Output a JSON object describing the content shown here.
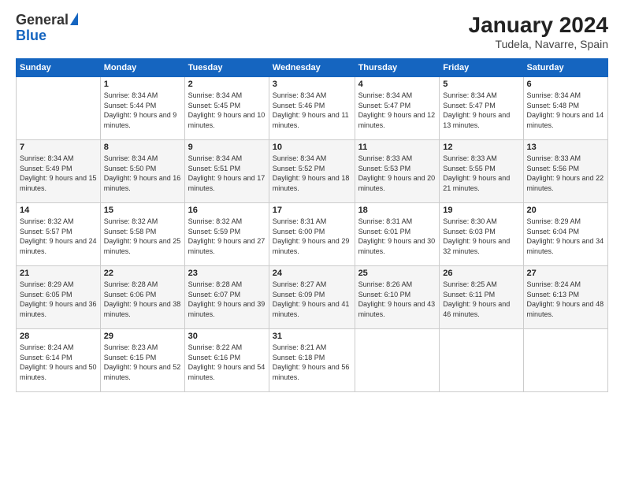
{
  "header": {
    "logo_general": "General",
    "logo_blue": "Blue",
    "month_title": "January 2024",
    "location": "Tudela, Navarre, Spain"
  },
  "days_of_week": [
    "Sunday",
    "Monday",
    "Tuesday",
    "Wednesday",
    "Thursday",
    "Friday",
    "Saturday"
  ],
  "weeks": [
    [
      {
        "day": "",
        "sunrise": "",
        "sunset": "",
        "daylight": ""
      },
      {
        "day": "1",
        "sunrise": "Sunrise: 8:34 AM",
        "sunset": "Sunset: 5:44 PM",
        "daylight": "Daylight: 9 hours and 9 minutes."
      },
      {
        "day": "2",
        "sunrise": "Sunrise: 8:34 AM",
        "sunset": "Sunset: 5:45 PM",
        "daylight": "Daylight: 9 hours and 10 minutes."
      },
      {
        "day": "3",
        "sunrise": "Sunrise: 8:34 AM",
        "sunset": "Sunset: 5:46 PM",
        "daylight": "Daylight: 9 hours and 11 minutes."
      },
      {
        "day": "4",
        "sunrise": "Sunrise: 8:34 AM",
        "sunset": "Sunset: 5:47 PM",
        "daylight": "Daylight: 9 hours and 12 minutes."
      },
      {
        "day": "5",
        "sunrise": "Sunrise: 8:34 AM",
        "sunset": "Sunset: 5:47 PM",
        "daylight": "Daylight: 9 hours and 13 minutes."
      },
      {
        "day": "6",
        "sunrise": "Sunrise: 8:34 AM",
        "sunset": "Sunset: 5:48 PM",
        "daylight": "Daylight: 9 hours and 14 minutes."
      }
    ],
    [
      {
        "day": "7",
        "sunrise": "Sunrise: 8:34 AM",
        "sunset": "Sunset: 5:49 PM",
        "daylight": "Daylight: 9 hours and 15 minutes."
      },
      {
        "day": "8",
        "sunrise": "Sunrise: 8:34 AM",
        "sunset": "Sunset: 5:50 PM",
        "daylight": "Daylight: 9 hours and 16 minutes."
      },
      {
        "day": "9",
        "sunrise": "Sunrise: 8:34 AM",
        "sunset": "Sunset: 5:51 PM",
        "daylight": "Daylight: 9 hours and 17 minutes."
      },
      {
        "day": "10",
        "sunrise": "Sunrise: 8:34 AM",
        "sunset": "Sunset: 5:52 PM",
        "daylight": "Daylight: 9 hours and 18 minutes."
      },
      {
        "day": "11",
        "sunrise": "Sunrise: 8:33 AM",
        "sunset": "Sunset: 5:53 PM",
        "daylight": "Daylight: 9 hours and 20 minutes."
      },
      {
        "day": "12",
        "sunrise": "Sunrise: 8:33 AM",
        "sunset": "Sunset: 5:55 PM",
        "daylight": "Daylight: 9 hours and 21 minutes."
      },
      {
        "day": "13",
        "sunrise": "Sunrise: 8:33 AM",
        "sunset": "Sunset: 5:56 PM",
        "daylight": "Daylight: 9 hours and 22 minutes."
      }
    ],
    [
      {
        "day": "14",
        "sunrise": "Sunrise: 8:32 AM",
        "sunset": "Sunset: 5:57 PM",
        "daylight": "Daylight: 9 hours and 24 minutes."
      },
      {
        "day": "15",
        "sunrise": "Sunrise: 8:32 AM",
        "sunset": "Sunset: 5:58 PM",
        "daylight": "Daylight: 9 hours and 25 minutes."
      },
      {
        "day": "16",
        "sunrise": "Sunrise: 8:32 AM",
        "sunset": "Sunset: 5:59 PM",
        "daylight": "Daylight: 9 hours and 27 minutes."
      },
      {
        "day": "17",
        "sunrise": "Sunrise: 8:31 AM",
        "sunset": "Sunset: 6:00 PM",
        "daylight": "Daylight: 9 hours and 29 minutes."
      },
      {
        "day": "18",
        "sunrise": "Sunrise: 8:31 AM",
        "sunset": "Sunset: 6:01 PM",
        "daylight": "Daylight: 9 hours and 30 minutes."
      },
      {
        "day": "19",
        "sunrise": "Sunrise: 8:30 AM",
        "sunset": "Sunset: 6:03 PM",
        "daylight": "Daylight: 9 hours and 32 minutes."
      },
      {
        "day": "20",
        "sunrise": "Sunrise: 8:29 AM",
        "sunset": "Sunset: 6:04 PM",
        "daylight": "Daylight: 9 hours and 34 minutes."
      }
    ],
    [
      {
        "day": "21",
        "sunrise": "Sunrise: 8:29 AM",
        "sunset": "Sunset: 6:05 PM",
        "daylight": "Daylight: 9 hours and 36 minutes."
      },
      {
        "day": "22",
        "sunrise": "Sunrise: 8:28 AM",
        "sunset": "Sunset: 6:06 PM",
        "daylight": "Daylight: 9 hours and 38 minutes."
      },
      {
        "day": "23",
        "sunrise": "Sunrise: 8:28 AM",
        "sunset": "Sunset: 6:07 PM",
        "daylight": "Daylight: 9 hours and 39 minutes."
      },
      {
        "day": "24",
        "sunrise": "Sunrise: 8:27 AM",
        "sunset": "Sunset: 6:09 PM",
        "daylight": "Daylight: 9 hours and 41 minutes."
      },
      {
        "day": "25",
        "sunrise": "Sunrise: 8:26 AM",
        "sunset": "Sunset: 6:10 PM",
        "daylight": "Daylight: 9 hours and 43 minutes."
      },
      {
        "day": "26",
        "sunrise": "Sunrise: 8:25 AM",
        "sunset": "Sunset: 6:11 PM",
        "daylight": "Daylight: 9 hours and 46 minutes."
      },
      {
        "day": "27",
        "sunrise": "Sunrise: 8:24 AM",
        "sunset": "Sunset: 6:13 PM",
        "daylight": "Daylight: 9 hours and 48 minutes."
      }
    ],
    [
      {
        "day": "28",
        "sunrise": "Sunrise: 8:24 AM",
        "sunset": "Sunset: 6:14 PM",
        "daylight": "Daylight: 9 hours and 50 minutes."
      },
      {
        "day": "29",
        "sunrise": "Sunrise: 8:23 AM",
        "sunset": "Sunset: 6:15 PM",
        "daylight": "Daylight: 9 hours and 52 minutes."
      },
      {
        "day": "30",
        "sunrise": "Sunrise: 8:22 AM",
        "sunset": "Sunset: 6:16 PM",
        "daylight": "Daylight: 9 hours and 54 minutes."
      },
      {
        "day": "31",
        "sunrise": "Sunrise: 8:21 AM",
        "sunset": "Sunset: 6:18 PM",
        "daylight": "Daylight: 9 hours and 56 minutes."
      },
      {
        "day": "",
        "sunrise": "",
        "sunset": "",
        "daylight": ""
      },
      {
        "day": "",
        "sunrise": "",
        "sunset": "",
        "daylight": ""
      },
      {
        "day": "",
        "sunrise": "",
        "sunset": "",
        "daylight": ""
      }
    ]
  ]
}
